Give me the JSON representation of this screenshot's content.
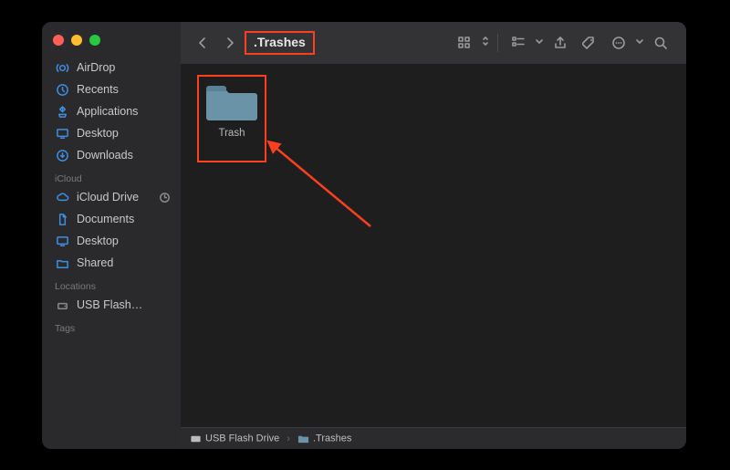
{
  "window": {
    "title": ".Trashes"
  },
  "sidebar": {
    "favorites": [
      {
        "label": "AirDrop",
        "icon": "airdrop-icon"
      },
      {
        "label": "Recents",
        "icon": "clock-icon"
      },
      {
        "label": "Applications",
        "icon": "apps-icon"
      },
      {
        "label": "Desktop",
        "icon": "desktop-icon"
      },
      {
        "label": "Downloads",
        "icon": "downloads-icon"
      }
    ],
    "icloud_label": "iCloud",
    "icloud": [
      {
        "label": "iCloud Drive",
        "icon": "cloud-icon",
        "trailing": "sync-icon"
      },
      {
        "label": "Documents",
        "icon": "doc-icon"
      },
      {
        "label": "Desktop",
        "icon": "desktop-icon"
      },
      {
        "label": "Shared",
        "icon": "shared-folder-icon"
      }
    ],
    "locations_label": "Locations",
    "locations": [
      {
        "label": "USB Flash…",
        "icon": "drive-icon"
      }
    ],
    "tags_label": "Tags"
  },
  "content": {
    "items": [
      {
        "label": "Trash",
        "icon": "folder-icon"
      }
    ]
  },
  "pathbar": {
    "segments": [
      {
        "label": "USB Flash Drive",
        "icon": "drive-icon"
      },
      {
        "label": ".Trashes",
        "icon": "folder-icon"
      }
    ]
  },
  "annotations": {
    "highlight": "title-and-trash-folder",
    "arrow": "points-to-trash-folder"
  }
}
